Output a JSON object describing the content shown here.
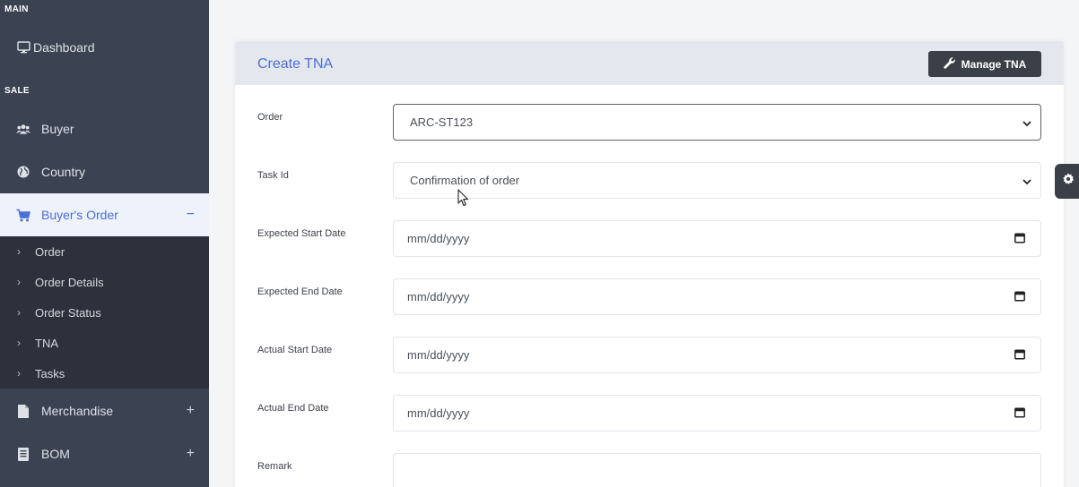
{
  "sidebar": {
    "sections": {
      "main": "MAIN",
      "sale": "SALE"
    },
    "items": {
      "dashboard": {
        "label": "Dashboard",
        "icon": "monitor-icon"
      },
      "buyer": {
        "label": "Buyer",
        "icon": "users-icon"
      },
      "country": {
        "label": "Country",
        "icon": "globe-icon"
      },
      "buyers_order": {
        "label": "Buyer's Order",
        "icon": "cart-icon",
        "toggle": "−"
      },
      "merchandise": {
        "label": "Merchandise",
        "icon": "file-icon",
        "toggle": "+"
      },
      "bom": {
        "label": "BOM",
        "icon": "receipt-icon",
        "toggle": "+"
      }
    },
    "submenu": [
      "Order",
      "Order Details",
      "Order Status",
      "TNA",
      "Tasks"
    ]
  },
  "card": {
    "title": "Create TNA",
    "manage_button": "Manage TNA"
  },
  "form": {
    "order": {
      "label": "Order",
      "value": "ARC-ST123"
    },
    "task_id": {
      "label": "Task Id",
      "value": "Confirmation of order"
    },
    "expected_start": {
      "label": "Expected Start Date",
      "placeholder": "mm/dd/yyyy"
    },
    "expected_end": {
      "label": "Expected End Date",
      "placeholder": "mm/dd/yyyy"
    },
    "actual_start": {
      "label": "Actual Start Date",
      "placeholder": "mm/dd/yyyy"
    },
    "actual_end": {
      "label": "Actual End Date",
      "placeholder": "mm/dd/yyyy"
    },
    "remark": {
      "label": "Remark",
      "value": ""
    }
  },
  "colors": {
    "sidebar_bg": "#3b4252",
    "submenu_bg": "#2c313c",
    "accent": "#4a6fd6",
    "active_bg": "#eef2fb",
    "button_dark": "#3b4048"
  }
}
